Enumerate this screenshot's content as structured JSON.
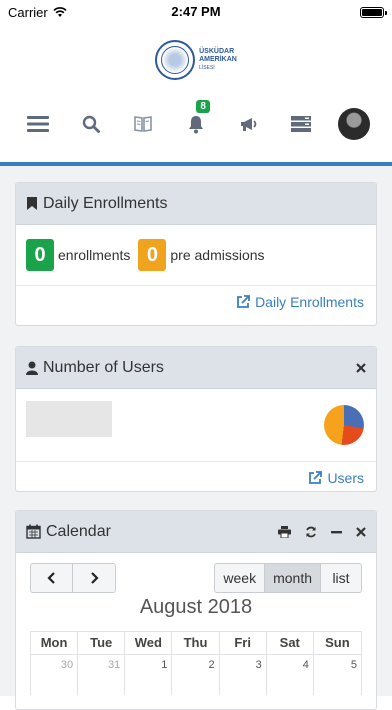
{
  "status_bar": {
    "carrier": "Carrier",
    "time": "2:47 PM"
  },
  "logo": {
    "line1": "ÜSKÜDAR",
    "line2": "AMERİKAN",
    "line3": "LİSESİ"
  },
  "toolbar": {
    "notifications_count": "8",
    "icons": [
      "menu-icon",
      "search-icon",
      "book-icon",
      "bell-icon",
      "megaphone-icon",
      "server-icon",
      "avatar"
    ]
  },
  "daily_enrollments": {
    "title": "Daily Enrollments",
    "enrollments_count": "0",
    "enrollments_label": "enrollments",
    "pre_admissions_count": "0",
    "pre_admissions_label": "pre admissions",
    "link_label": "Daily Enrollments"
  },
  "number_of_users": {
    "title": "Number of Users",
    "link_label": "Users",
    "pie_colors": [
      "#4a6fb5",
      "#e64b1c",
      "#f6a21c"
    ]
  },
  "calendar": {
    "title": "Calendar",
    "prev_label": "‹",
    "next_label": "›",
    "views": [
      "week",
      "month",
      "list"
    ],
    "active_view": "month",
    "month_title": "August 2018",
    "weekdays": [
      "Mon",
      "Tue",
      "Wed",
      "Thu",
      "Fri",
      "Sat",
      "Sun"
    ],
    "first_week": [
      "30",
      "31",
      "1",
      "2",
      "3",
      "4",
      "5"
    ]
  },
  "colors": {
    "accent": "#3a7fc1",
    "success": "#1aa34a",
    "warning": "#f0a31c"
  }
}
